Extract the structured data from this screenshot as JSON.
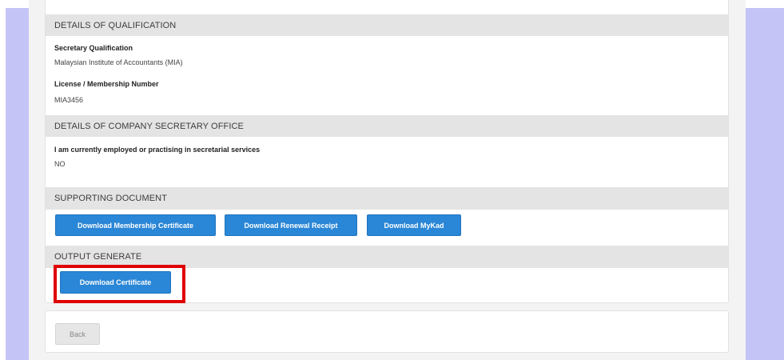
{
  "qualification": {
    "header": "DETAILS OF QUALIFICATION",
    "secretary_label": "Secretary Qualification",
    "secretary_value": "Malaysian Institute of Accountants (MIA)",
    "license_label": "License / Membership Number",
    "license_value": "MIA3456"
  },
  "office": {
    "header": "DETAILS OF COMPANY SECRETARY OFFICE",
    "employed_label": "I am currently employed or practising in secretarial services",
    "employed_value": "NO"
  },
  "supporting": {
    "header": "SUPPORTING DOCUMENT",
    "buttons": [
      "Download Membership Certificate",
      "Download Renewal Receipt",
      "Download MyKad"
    ]
  },
  "output": {
    "header": "OUTPUT GENERATE",
    "download_certificate": "Download Certificate"
  },
  "footer": {
    "back_label": "Back"
  },
  "colors": {
    "side_band": "#c4c4f7",
    "primary_button": "#2a86d6",
    "highlight": "#e00000",
    "section_header": "#e4e4e4"
  }
}
